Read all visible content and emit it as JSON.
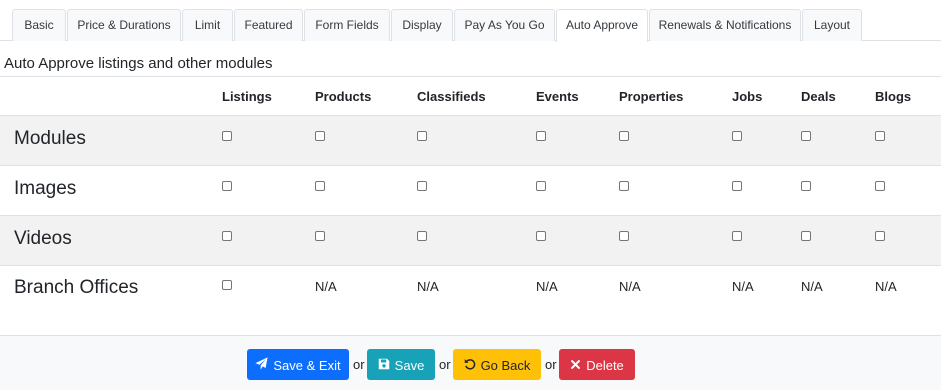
{
  "tabs": [
    {
      "label": "Basic",
      "active": false
    },
    {
      "label": "Price & Durations",
      "active": false
    },
    {
      "label": "Limit",
      "active": false
    },
    {
      "label": "Featured",
      "active": false
    },
    {
      "label": "Form Fields",
      "active": false
    },
    {
      "label": "Display",
      "active": false
    },
    {
      "label": "Pay As You Go",
      "active": false
    },
    {
      "label": "Auto Approve",
      "active": true
    },
    {
      "label": "Renewals & Notifications",
      "active": false
    },
    {
      "label": "Layout",
      "active": false
    }
  ],
  "heading": "Auto Approve listings and other modules",
  "columns": [
    "Listings",
    "Products",
    "Classifieds",
    "Events",
    "Properties",
    "Jobs",
    "Deals",
    "Blogs"
  ],
  "rows": [
    {
      "label": "Modules",
      "cells": [
        "checkbox",
        "checkbox",
        "checkbox",
        "checkbox",
        "checkbox",
        "checkbox",
        "checkbox",
        "checkbox"
      ]
    },
    {
      "label": "Images",
      "cells": [
        "checkbox",
        "checkbox",
        "checkbox",
        "checkbox",
        "checkbox",
        "checkbox",
        "checkbox",
        "checkbox"
      ]
    },
    {
      "label": "Videos",
      "cells": [
        "checkbox",
        "checkbox",
        "checkbox",
        "checkbox",
        "checkbox",
        "checkbox",
        "checkbox",
        "checkbox"
      ]
    },
    {
      "label": "Branch Offices",
      "cells": [
        "checkbox",
        "N/A",
        "N/A",
        "N/A",
        "N/A",
        "N/A",
        "N/A",
        "N/A"
      ]
    }
  ],
  "actions": {
    "save_exit": "Save & Exit",
    "save": "Save",
    "go_back": "Go Back",
    "delete": "Delete",
    "separator": "or"
  },
  "colors": {
    "primary": "#0d6efd",
    "info": "#17a2b8",
    "warning": "#ffc107",
    "danger": "#dc3545"
  }
}
